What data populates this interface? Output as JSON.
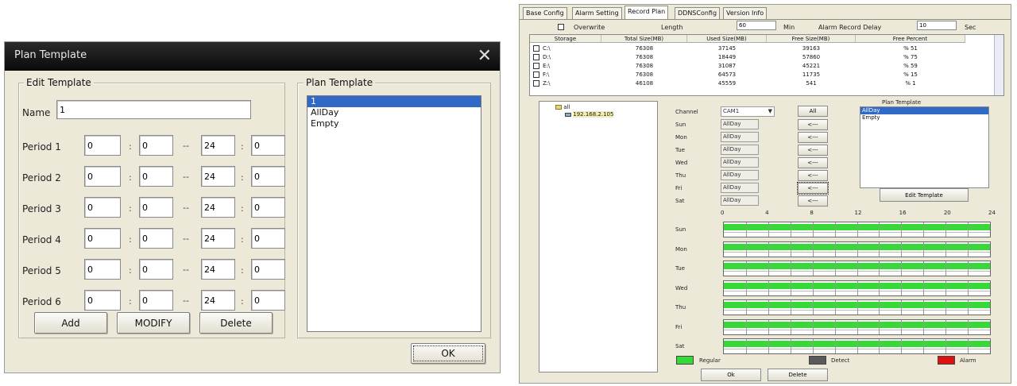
{
  "dialog": {
    "title": "Plan Template",
    "edit_group_label": "Edit Template",
    "name_label": "Name",
    "name_value": "1",
    "periods": [
      {
        "label": "Period 1",
        "start_h": "0",
        "start_sep": ":",
        "start_m": "0",
        "dash": "--",
        "end_h": "24",
        "end_sep": ":",
        "end_m": "0"
      },
      {
        "label": "Period 2",
        "start_h": "0",
        "start_sep": ":",
        "start_m": "0",
        "dash": "--",
        "end_h": "24",
        "end_sep": ":",
        "end_m": "0"
      },
      {
        "label": "Period 3",
        "start_h": "0",
        "start_sep": ":",
        "start_m": "0",
        "dash": "--",
        "end_h": "24",
        "end_sep": ":",
        "end_m": "0"
      },
      {
        "label": "Period 4",
        "start_h": "0",
        "start_sep": ":",
        "start_m": "0",
        "dash": "--",
        "end_h": "24",
        "end_sep": ":",
        "end_m": "0"
      },
      {
        "label": "Period 5",
        "start_h": "0",
        "start_sep": ":",
        "start_m": "0",
        "dash": "--",
        "end_h": "24",
        "end_sep": ":",
        "end_m": "0"
      },
      {
        "label": "Period 6",
        "start_h": "0",
        "start_sep": ":",
        "start_m": "0",
        "dash": "--",
        "end_h": "24",
        "end_sep": ":",
        "end_m": "0"
      }
    ],
    "buttons": {
      "add": "Add",
      "modify": "MODIFY",
      "delete": "Delete",
      "ok": "OK"
    },
    "plan_group_label": "Plan Template",
    "plan_items": [
      "1",
      "AllDay",
      "Empty"
    ]
  },
  "right": {
    "tabs": [
      "Base Config",
      "Alarm Setting",
      "Record Plan",
      "DDNSConfig",
      "Version Info"
    ],
    "active_tab": "Record Plan",
    "overwrite_label": "Overwrite",
    "length_label": "Length",
    "length_value": "60",
    "min_label": "Min",
    "delay_label": "Alarm Record Delay",
    "delay_value": "10",
    "sec_label": "Sec",
    "storage": {
      "headers": [
        "Storage",
        "Total Size(MB)",
        "Used Size(MB)",
        "Free Size(MB)",
        "Free Percent"
      ],
      "rows": [
        [
          "C:\\",
          "76308",
          "37145",
          "39163",
          "% 51"
        ],
        [
          "D:\\",
          "76308",
          "18449",
          "57860",
          "% 75"
        ],
        [
          "E:\\",
          "76308",
          "31087",
          "45221",
          "% 59"
        ],
        [
          "F:\\",
          "76308",
          "64573",
          "11735",
          "% 15"
        ],
        [
          "Z:\\",
          "46108",
          "45559",
          "541",
          "% 1"
        ]
      ]
    },
    "tree": {
      "root": "all",
      "child": "192.168.2.105"
    },
    "channel_label": "Channel",
    "channel_value": "CAM1",
    "days": [
      "Sun",
      "Mon",
      "Tue",
      "Wed",
      "Thu",
      "Fri",
      "Sat"
    ],
    "day_values": [
      "AllDay",
      "AllDay",
      "AllDay",
      "AllDay",
      "AllDay",
      "AllDay",
      "AllDay"
    ],
    "all_button": "All",
    "arrow_button": "<---",
    "plan_group_label": "Plan Template",
    "plan_items": [
      "AllDay",
      "Empty"
    ],
    "edit_template_button": "Edit Template",
    "hours": [
      "0",
      "4",
      "8",
      "12",
      "16",
      "20",
      "24"
    ],
    "schedule_fill": [
      1,
      1,
      1,
      1,
      1,
      1,
      1
    ],
    "legend": [
      {
        "label": "Regular",
        "color": "#38d838"
      },
      {
        "label": "Detect",
        "color": "#5a5a5a"
      },
      {
        "label": "Alarm",
        "color": "#e01010"
      }
    ],
    "ok_button": "Ok",
    "delete_button": "Delete"
  }
}
